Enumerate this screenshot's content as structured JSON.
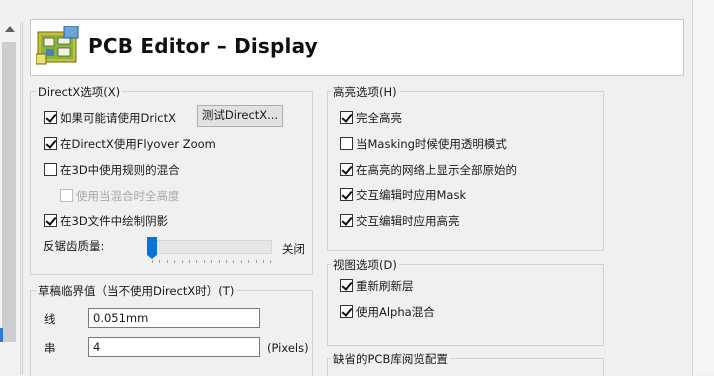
{
  "header": {
    "title": "PCB Editor – Display"
  },
  "directx": {
    "legend": "DirectX选项(X)",
    "use_directx": {
      "label": "如果可能请使用DrictX",
      "checked": true
    },
    "test_button": "测试DirectX...",
    "flyover": {
      "label": "在DirectX使用Flyover Zoom",
      "checked": true
    },
    "blend3d": {
      "label": "在3D中使用规则的混合",
      "checked": false
    },
    "full_brightness": {
      "label": "使用当混合时全高度",
      "checked": false,
      "disabled": true
    },
    "shadows3d": {
      "label": "在3D文件中绘制阴影",
      "checked": true
    },
    "antialias": {
      "label": "反锯齿质量:",
      "value_label": "关闭",
      "level": 0
    }
  },
  "draft": {
    "legend": "草稿临界值（当不使用DirectX时）(T)",
    "line": {
      "label": "线",
      "value": "0.051mm"
    },
    "string": {
      "label": "串",
      "value": "4",
      "unit": "(Pixels)"
    }
  },
  "highlight": {
    "legend": "高亮选项(H)",
    "items": [
      {
        "label": "完全高亮",
        "checked": true
      },
      {
        "label": "当Masking时候使用透明模式",
        "checked": false
      },
      {
        "label": "在高亮的网络上显示全部原始的",
        "checked": true
      },
      {
        "label": "交互编辑时应用Mask",
        "checked": true
      },
      {
        "label": "交互编辑时应用高亮",
        "checked": true
      }
    ]
  },
  "view": {
    "legend": "视图选项(D)",
    "items": [
      {
        "label": "重新刷新层",
        "checked": true
      },
      {
        "label": "使用Alpha混合",
        "checked": true
      }
    ]
  },
  "library": {
    "legend": "缺省的PCB库阅览配置"
  }
}
